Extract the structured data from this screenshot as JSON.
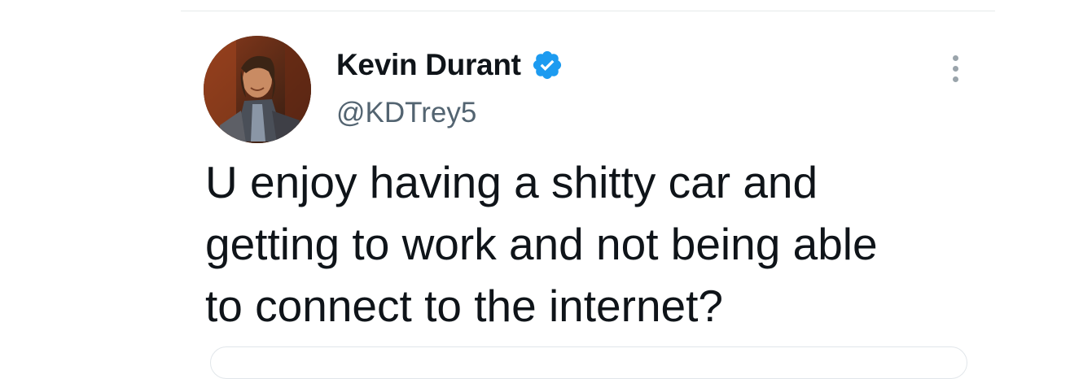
{
  "tweet": {
    "author": {
      "display_name": "Kevin Durant",
      "handle": "@KDTrey5",
      "verified": true,
      "avatar_icon": "profile-avatar"
    },
    "text_lines": [
      "U enjoy having a shitty car and",
      "getting to work and not being able",
      "to connect to the internet?"
    ],
    "menu_icon": "more-vertical-icon"
  },
  "colors": {
    "text_primary": "#0f1419",
    "text_secondary": "#536471",
    "verified_blue": "#1d9bf0",
    "divider": "#e6e9eb"
  }
}
